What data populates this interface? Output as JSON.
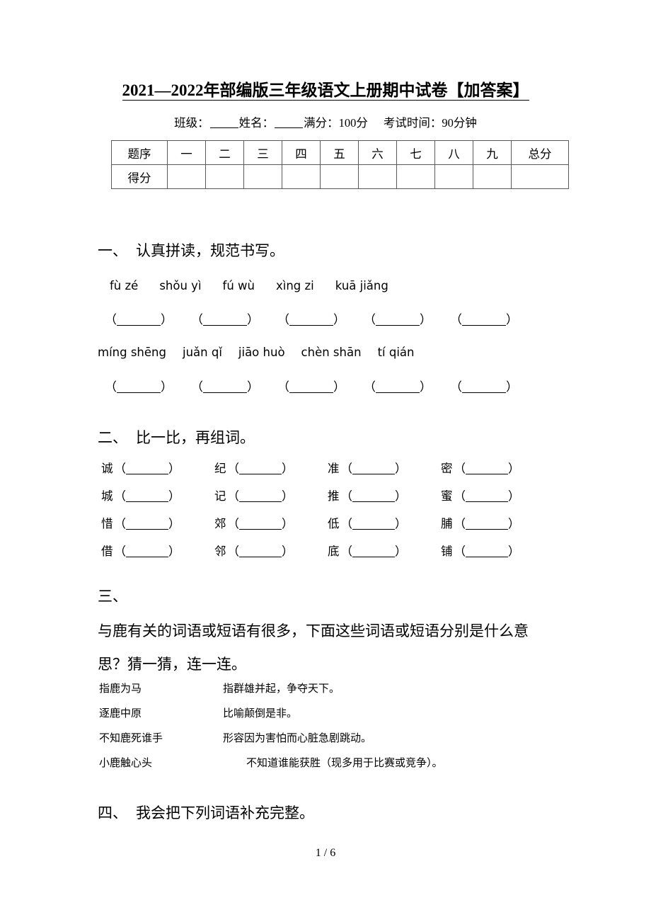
{
  "document": {
    "title_plain": "2021—2022年部编版三年级语文上册期中试卷【加答案】",
    "page_footer": "1 / 6"
  },
  "info": {
    "class_label": "班级：",
    "name_label": "姓名：",
    "full_score_label": "满分：",
    "full_score_value": "100分",
    "time_label": "考试时间：",
    "time_value": "90分钟"
  },
  "score_table": {
    "row_labels": [
      "题序",
      "得分"
    ],
    "columns": [
      "一",
      "二",
      "三",
      "四",
      "五",
      "六",
      "七",
      "八",
      "九"
    ],
    "total_column": "总分"
  },
  "section1": {
    "index": "一、",
    "title": "认真拼读，规范书写。",
    "pinyin_rows": [
      [
        "fù zé",
        "shǒu yì",
        "fú wù",
        "xìng zi",
        "kuā jiǎng"
      ],
      [
        "míng shēng",
        "juǎn qǐ",
        "jiāo huò",
        "chèn shān",
        "tí qián"
      ]
    ],
    "blank_count_per_row": 5
  },
  "section2": {
    "index": "二、",
    "title": "比一比，再组词。",
    "rows": [
      [
        "诚",
        "纪",
        "准",
        "密"
      ],
      [
        "城",
        "记",
        "推",
        "蜜"
      ],
      [
        "惜",
        "郊",
        "低",
        "脯"
      ],
      [
        "借",
        "邻",
        "底",
        "铺"
      ]
    ]
  },
  "section3": {
    "index": "三、",
    "title": "",
    "prompt": "与鹿有关的词语或短语有很多，下面这些词语或短语分别是什么意思？猜一猜，连一连。",
    "pairs": [
      {
        "term": "指鹿为马",
        "meaning": "指群雄并起，争夺天下。"
      },
      {
        "term": "逐鹿中原",
        "meaning": "比喻颠倒是非。"
      },
      {
        "term": "不知鹿死谁手",
        "meaning": "形容因为害怕而心脏急剧跳动。"
      },
      {
        "term": "小鹿触心头",
        "meaning": "不知道谁能获胜（现多用于比赛或竞争）。"
      }
    ]
  },
  "section4": {
    "index": "四、",
    "title": "我会把下列词语补充完整。"
  }
}
